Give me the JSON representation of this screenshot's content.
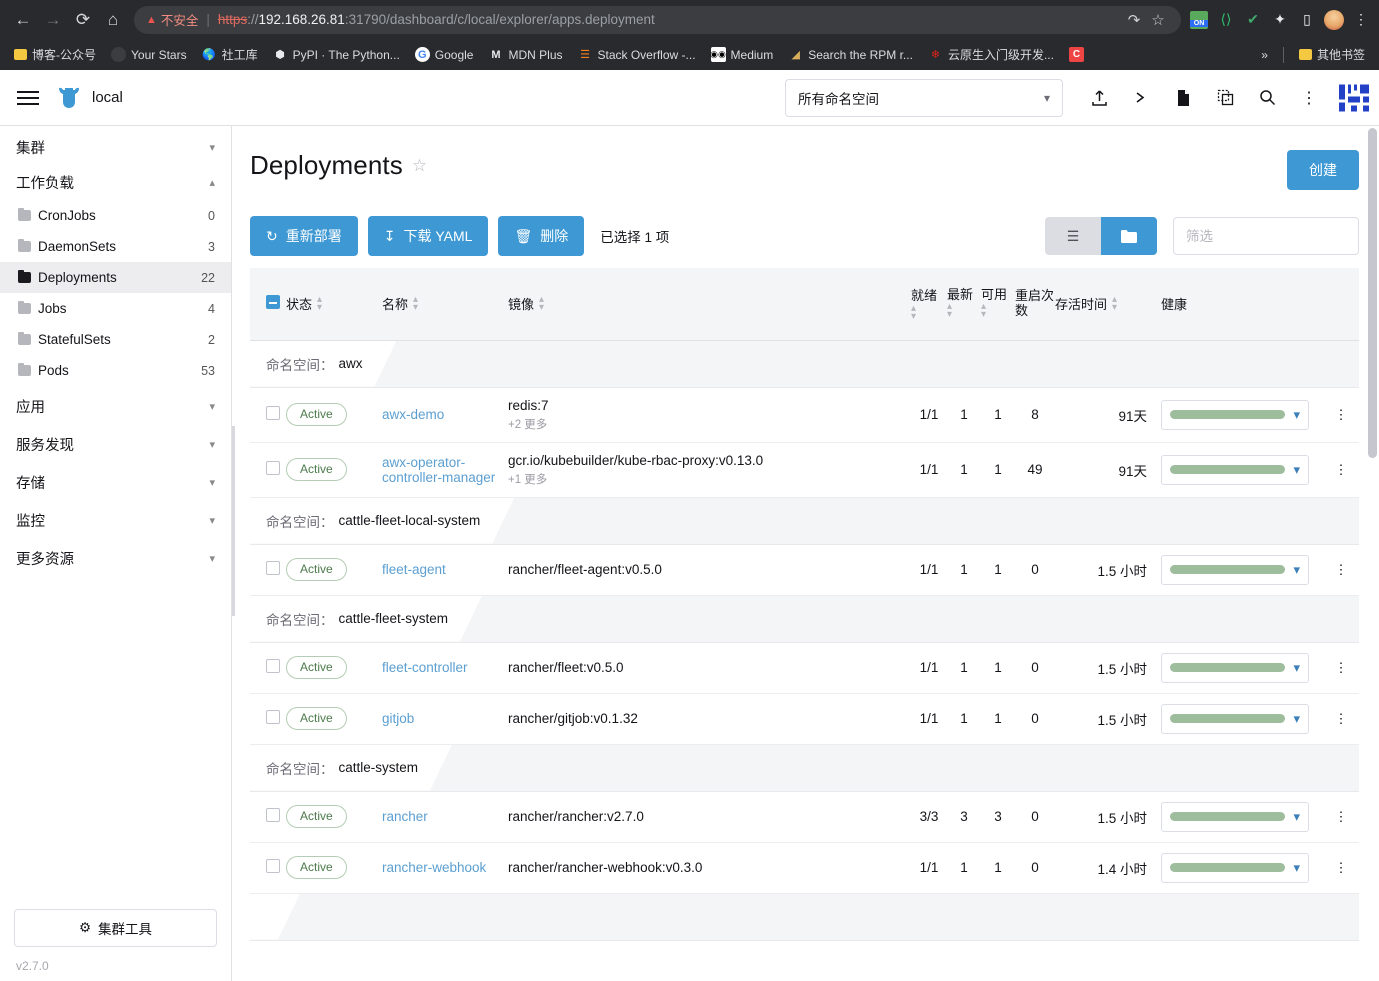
{
  "browser": {
    "nav": {
      "back": "←",
      "forward": "→",
      "reload": "⟳",
      "home": "⌂"
    },
    "security_warning": "不安全",
    "url_scheme": "https",
    "url_sep": "://",
    "url_host": "192.168.26.81",
    "url_rest": ":31790/dashboard/c/local/explorer/apps.deployment",
    "omnibox_icons": [
      "share-icon",
      "bookmark-star-icon"
    ],
    "extensions": [
      {
        "name": "adblock-on-icon",
        "label": "ON"
      },
      {
        "name": "brackets-icon",
        "label": "⟨⟩"
      },
      {
        "name": "check-circle-icon",
        "label": "✔"
      },
      {
        "name": "puzzle-extension-icon",
        "label": "🧩"
      },
      {
        "name": "sidepanel-icon",
        "label": "▯"
      },
      {
        "name": "profile-avatar",
        "label": ""
      },
      {
        "name": "chrome-menu-icon",
        "label": "⋮"
      }
    ],
    "bookmarks": [
      {
        "label": "博客-公众号",
        "icon": "folder-icon"
      },
      {
        "label": "Your Stars",
        "icon": "github-icon"
      },
      {
        "label": "社工库",
        "icon": "globe-icon"
      },
      {
        "label": "PyPI · The Python...",
        "icon": "package-icon"
      },
      {
        "label": "Google",
        "icon": "google-icon"
      },
      {
        "label": "MDN Plus",
        "icon": "mdn-icon"
      },
      {
        "label": "Stack Overflow -...",
        "icon": "stackoverflow-icon"
      },
      {
        "label": "Medium",
        "icon": "medium-icon"
      },
      {
        "label": "Search the RPM r...",
        "icon": "rpm-icon"
      },
      {
        "label": "云原生入门级开发...",
        "icon": "huawei-icon"
      },
      {
        "label": "",
        "icon": "c-icon"
      }
    ],
    "overflow": "»",
    "other_bookmarks": "其他书签"
  },
  "header": {
    "cluster_name": "local",
    "namespace_filter": "所有命名空间",
    "icons": [
      "import-yaml-icon",
      "kubectl-shell-icon",
      "yaml-file-icon",
      "copy-kubeconfig-icon",
      "search-icon",
      "more-options-icon"
    ],
    "logo": "rancher-logo"
  },
  "sidebar": {
    "groups": [
      {
        "label": "集群",
        "expanded": false
      },
      {
        "label": "工作负载",
        "expanded": true
      }
    ],
    "workload_items": [
      {
        "label": "CronJobs",
        "count": "0",
        "active": false
      },
      {
        "label": "DaemonSets",
        "count": "3",
        "active": false
      },
      {
        "label": "Deployments",
        "count": "22",
        "active": true
      },
      {
        "label": "Jobs",
        "count": "4",
        "active": false
      },
      {
        "label": "StatefulSets",
        "count": "2",
        "active": false
      },
      {
        "label": "Pods",
        "count": "53",
        "active": false
      }
    ],
    "more_groups": [
      {
        "label": "应用"
      },
      {
        "label": "服务发现"
      },
      {
        "label": "存储"
      },
      {
        "label": "监控"
      },
      {
        "label": "更多资源"
      }
    ],
    "tools_button": "集群工具",
    "version": "v2.7.0"
  },
  "page": {
    "title": "Deployments",
    "create_button": "创建",
    "actions": [
      {
        "label": "重新部署",
        "icon": "refresh-icon"
      },
      {
        "label": "下载 YAML",
        "icon": "download-icon"
      },
      {
        "label": "删除",
        "icon": "trash-icon"
      }
    ],
    "selection_text": "已选择 1 项",
    "view_list_icon": "list-view-icon",
    "view_group_icon": "group-view-icon",
    "filter_placeholder": "筛选",
    "filter_value": ""
  },
  "table": {
    "columns": [
      {
        "key": "state",
        "label": "状态",
        "sortable": true
      },
      {
        "key": "name",
        "label": "名称",
        "sortable": true
      },
      {
        "key": "image",
        "label": "镜像",
        "sortable": true
      },
      {
        "key": "ready",
        "label": "就绪",
        "sortable": true
      },
      {
        "key": "uptodate",
        "label": "最新",
        "sortable": true
      },
      {
        "key": "available",
        "label": "可用",
        "sortable": true
      },
      {
        "key": "restarts",
        "label": "重启次数",
        "sortable": false
      },
      {
        "key": "age",
        "label": "存活时间",
        "sortable": true
      },
      {
        "key": "health",
        "label": "健康",
        "sortable": false
      }
    ],
    "namespace_prefix": "命名空间：",
    "groups": [
      {
        "namespace": "awx",
        "rows": [
          {
            "state": "Active",
            "name": "awx-demo",
            "image": "redis:7",
            "image_more": "+2 更多",
            "ready": "1/1",
            "uptodate": "1",
            "available": "1",
            "restarts": "8",
            "age": "91天"
          },
          {
            "state": "Active",
            "name": "awx-operator-controller-manager",
            "image": "gcr.io/kubebuilder/kube-rbac-proxy:v0.13.0",
            "image_more": "+1 更多",
            "ready": "1/1",
            "uptodate": "1",
            "available": "1",
            "restarts": "49",
            "age": "91天"
          }
        ]
      },
      {
        "namespace": "cattle-fleet-local-system",
        "rows": [
          {
            "state": "Active",
            "name": "fleet-agent",
            "image": "rancher/fleet-agent:v0.5.0",
            "image_more": "",
            "ready": "1/1",
            "uptodate": "1",
            "available": "1",
            "restarts": "0",
            "age": "1.5 小时"
          }
        ]
      },
      {
        "namespace": "cattle-fleet-system",
        "rows": [
          {
            "state": "Active",
            "name": "fleet-controller",
            "image": "rancher/fleet:v0.5.0",
            "image_more": "",
            "ready": "1/1",
            "uptodate": "1",
            "available": "1",
            "restarts": "0",
            "age": "1.5 小时"
          },
          {
            "state": "Active",
            "name": "gitjob",
            "image": "rancher/gitjob:v0.1.32",
            "image_more": "",
            "ready": "1/1",
            "uptodate": "1",
            "available": "1",
            "restarts": "0",
            "age": "1.5 小时"
          }
        ]
      },
      {
        "namespace": "cattle-system",
        "rows": [
          {
            "state": "Active",
            "name": "rancher",
            "image": "rancher/rancher:v2.7.0",
            "image_more": "",
            "ready": "3/3",
            "uptodate": "3",
            "available": "3",
            "restarts": "0",
            "age": "1.5 小时"
          },
          {
            "state": "Active",
            "name": "rancher-webhook",
            "image": "rancher/rancher-webhook:v0.3.0",
            "image_more": "",
            "ready": "1/1",
            "uptodate": "1",
            "available": "1",
            "restarts": "0",
            "age": "1.4 小时"
          }
        ]
      }
    ]
  },
  "colors": {
    "accent": "#3d98d3",
    "link": "#5b9fd1",
    "active_badge_text": "#4c7a4c",
    "active_badge_border": "#b4cdb4",
    "health_bar": "#9dbd9d",
    "header_bg": "#f4f5f7",
    "browser_bg": "#292a2d"
  }
}
